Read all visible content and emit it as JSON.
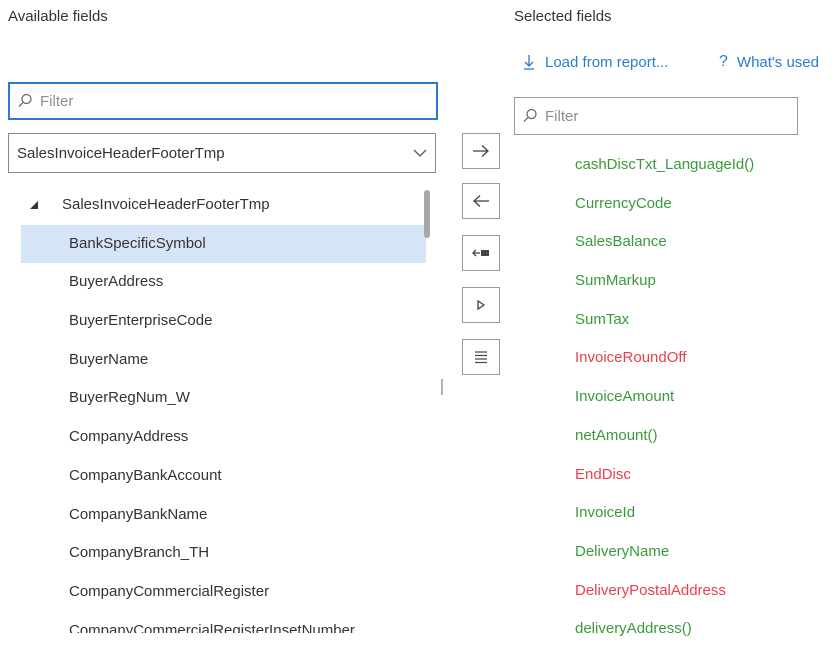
{
  "left_panel": {
    "heading": "Available fields",
    "filter_placeholder": "Filter",
    "table_select_value": "SalesInvoiceHeaderFooterTmp",
    "tree_root": "SalesInvoiceHeaderFooterTmp",
    "fields": [
      "BankSpecificSymbol",
      "BuyerAddress",
      "BuyerEnterpriseCode",
      "BuyerName",
      "BuyerRegNum_W",
      "CompanyAddress",
      "CompanyBankAccount",
      "CompanyBankName",
      "CompanyBranch_TH",
      "CompanyCommercialRegister",
      "CompanyCommercialRegisterInsetNumber"
    ],
    "selected_field": "BankSpecificSymbol"
  },
  "right_panel": {
    "heading": "Selected fields",
    "load_link": "Load from report...",
    "whats_used_link": "What's used",
    "filter_placeholder": "Filter",
    "fields": [
      {
        "name": "cashDiscTxt_LanguageId()",
        "status": "valid"
      },
      {
        "name": "CurrencyCode",
        "status": "valid"
      },
      {
        "name": "SalesBalance",
        "status": "valid"
      },
      {
        "name": "SumMarkup",
        "status": "valid"
      },
      {
        "name": "SumTax",
        "status": "valid"
      },
      {
        "name": "InvoiceRoundOff",
        "status": "invalid"
      },
      {
        "name": "InvoiceAmount",
        "status": "valid"
      },
      {
        "name": "netAmount()",
        "status": "valid"
      },
      {
        "name": "EndDisc",
        "status": "invalid"
      },
      {
        "name": "InvoiceId",
        "status": "valid"
      },
      {
        "name": "DeliveryName",
        "status": "valid"
      },
      {
        "name": "DeliveryPostalAddress",
        "status": "invalid"
      },
      {
        "name": "deliveryAddress()",
        "status": "valid"
      }
    ]
  },
  "colors": {
    "accent": "#2b7bd3",
    "valid": "#3a9a3a",
    "invalid": "#e8414c",
    "selection": "#d6e4f8"
  },
  "icons": {
    "add": "arrow-right-icon",
    "remove": "arrow-left-icon",
    "remove_all": "remove-all-icon",
    "expand": "play-icon",
    "details": "list-icon"
  }
}
